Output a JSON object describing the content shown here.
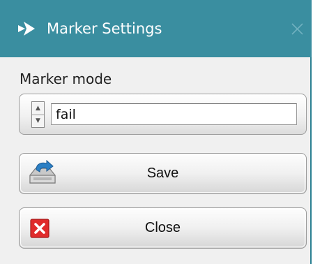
{
  "window": {
    "title": "Marker Settings",
    "title_bar_color": "#3a8ea0"
  },
  "icons": {
    "app": "app-logo-icon",
    "window_close": "close-icon",
    "spin_up": "chevron-up-icon",
    "spin_down": "chevron-down-icon",
    "save": "save-icon",
    "close_button": "close-red-x-icon"
  },
  "marker_mode": {
    "label": "Marker mode",
    "value": "fail"
  },
  "buttons": {
    "save_label": "Save",
    "close_label": "Close"
  }
}
